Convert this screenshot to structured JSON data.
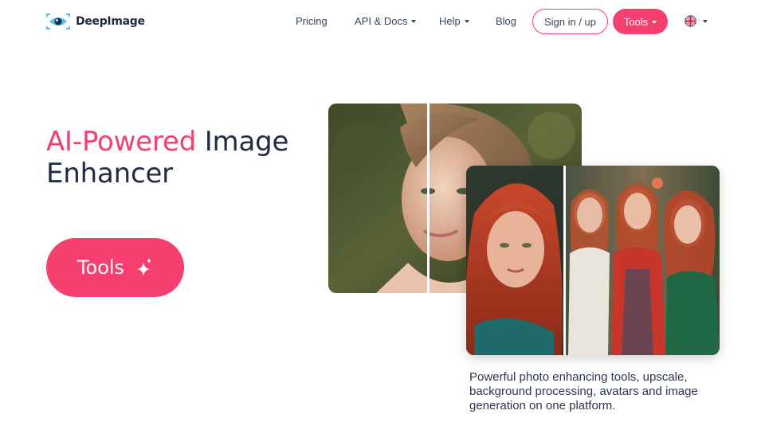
{
  "brand": {
    "name": "DeepImage"
  },
  "nav": {
    "pricing": "Pricing",
    "api_docs": "API & Docs",
    "help": "Help",
    "blog": "Blog",
    "signin": "Sign in / up",
    "tools": "Tools",
    "language_icon": "uk-flag-icon"
  },
  "hero": {
    "title_accent": "AI-Powered",
    "title_rest_1": "Image",
    "title_rest_2": "Enhancer",
    "cta_label": "Tools",
    "cta_icon": "sparkle-icon",
    "description": "Powerful photo enhancing tools, upscale, background processing, avatars and image generation on one platform."
  },
  "colors": {
    "accent": "#f43f6f",
    "text": "#1f2a44"
  }
}
